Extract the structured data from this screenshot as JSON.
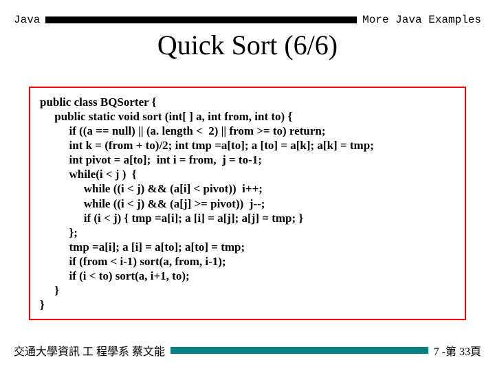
{
  "header": {
    "left": "Java",
    "right": "More Java Examples"
  },
  "title": "Quick Sort (6/6)",
  "code": {
    "l01": "public class BQSorter {",
    "l02": "     public static void sort (int[ ] a, int from, int to) {",
    "l03": "          if ((a == null) || (a. length <  2) || from >= to) return;",
    "l04": "          int k = (from + to)/2; int tmp =a[to]; a [to] = a[k]; a[k] = tmp;",
    "l05": "          int pivot = a[to];  int i = from,  j = to-1;",
    "l06": "          while(i < j )  {",
    "l07": "               while ((i < j) && (a[i] < pivot))  i++;",
    "l08": "               while ((i < j) && (a[j] >= pivot))  j--;",
    "l09": "               if (i < j) { tmp =a[i]; a [i] = a[j]; a[j] = tmp; }",
    "l10": "          };",
    "l11": "          tmp =a[i]; a [i] = a[to]; a[to] = tmp;",
    "l12": "          if (from < i-1) sort(a, from, i-1);",
    "l13": "          if (i < to) sort(a, i+1, to);",
    "l14": "     }",
    "l15": "}"
  },
  "footer": {
    "left": "交通大學資訊 工 程學系  蔡文能",
    "right": "7 -第 33頁"
  }
}
